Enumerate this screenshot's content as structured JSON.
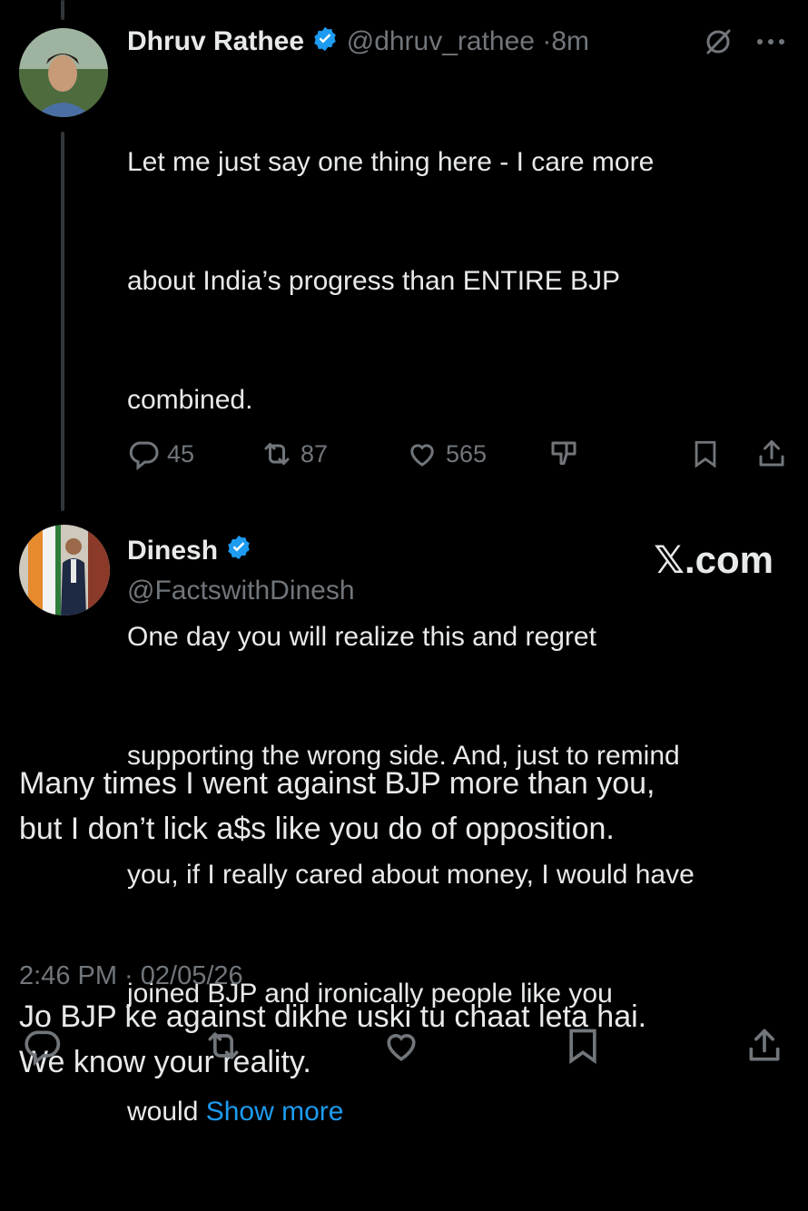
{
  "quoted_tweet": {
    "author_name": "Dhruv Rathee",
    "handle": "@dhruv_rathee",
    "separator": "·",
    "time": "8m",
    "text_lines": [
      "Let me just say one thing here - I care more",
      "about India’s progress than ENTIRE BJP",
      "combined.",
      "",
      "One day you will realize this and regret",
      "supporting the wrong side. And, just to remind",
      "you, if I really cared about money, I would have",
      "joined BJP and ironically people like you"
    ],
    "last_line_text": "would",
    "show_more": "Show more",
    "actions": {
      "replies": "45",
      "reposts": "87",
      "likes": "565"
    }
  },
  "main_tweet": {
    "author_name": "Dinesh",
    "handle": "@FactswithDinesh",
    "text_paragraph_1": "Many times I went against BJP more than you,\nbut I don’t lick a$s like you do of opposition.",
    "text_paragraph_2": "Jo BJP ke against dikhe uski tu chaat leta hai.\nWe know your reality.",
    "timestamp": "2:46 PM · 02/05/26"
  },
  "watermark": "𝕏.com",
  "colors": {
    "background": "#000000",
    "text": "#e7e9ea",
    "muted": "#71767b",
    "link": "#1d9bf0",
    "verified": "#1d9bf0"
  },
  "icons": [
    "reply-icon",
    "repost-icon",
    "like-icon",
    "downvote-icon",
    "bookmark-icon",
    "share-icon",
    "grok-icon",
    "more-icon",
    "verified-badge-icon"
  ]
}
